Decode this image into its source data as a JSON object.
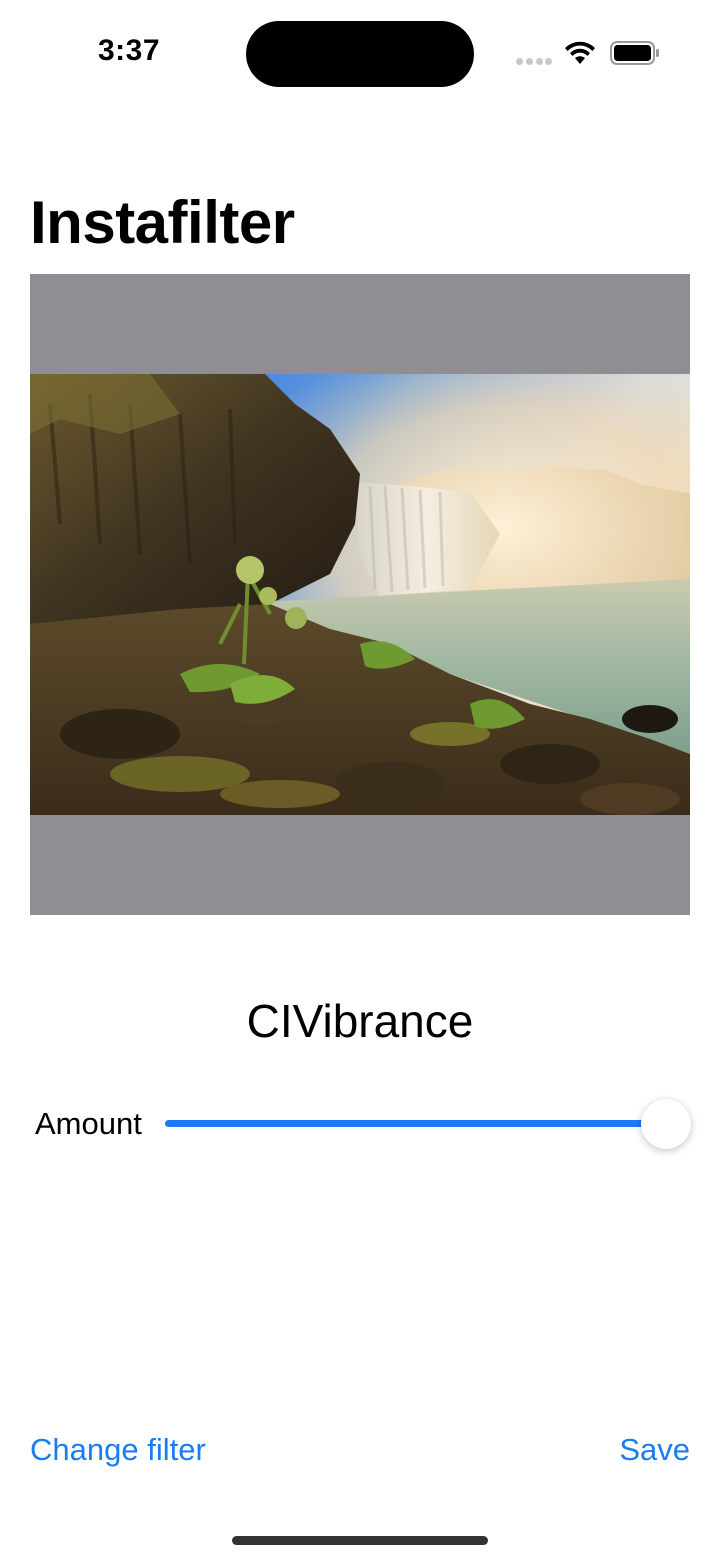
{
  "status_bar": {
    "time": "3:37",
    "icons": [
      "signal-icon",
      "wifi-icon",
      "battery-icon"
    ]
  },
  "title": "Instafilter",
  "image": {
    "description_icon": "photo-waterfall",
    "frame_color": "#8e8e93"
  },
  "filter": {
    "name": "CIVibrance"
  },
  "slider": {
    "label": "Amount",
    "value": 1.0,
    "accent": "#1a7cf5"
  },
  "actions": {
    "change_filter": "Change filter",
    "save": "Save"
  }
}
